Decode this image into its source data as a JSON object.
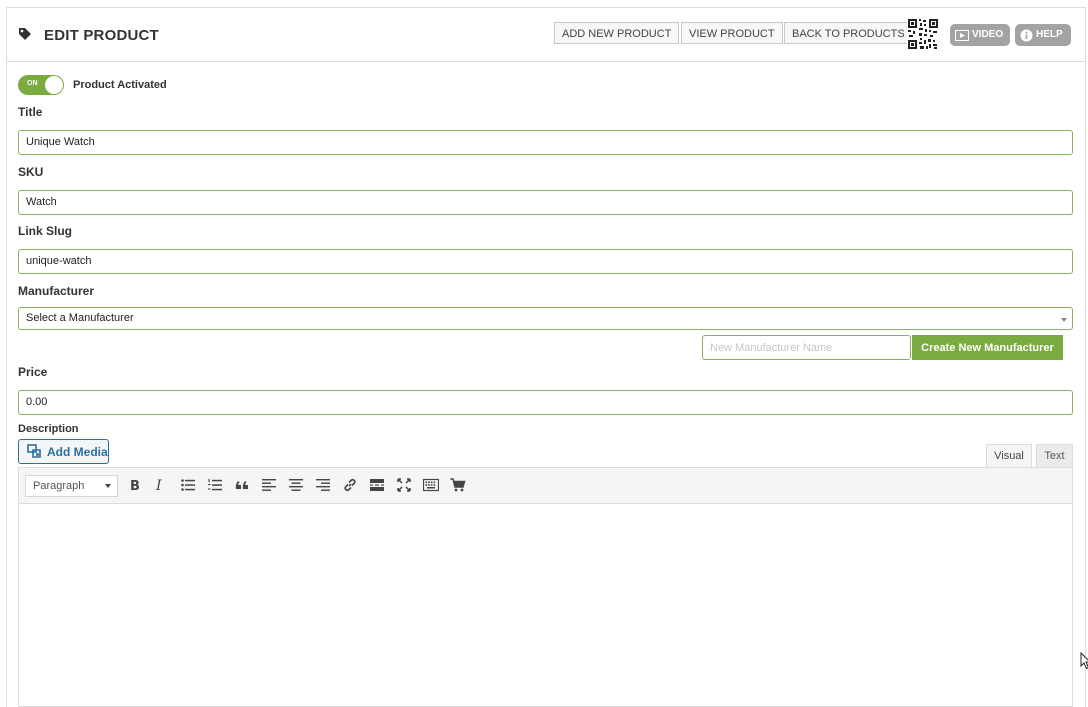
{
  "header": {
    "title": "EDIT PRODUCT",
    "buttons": {
      "add_new_product": "ADD NEW PRODUCT",
      "view_product": "VIEW PRODUCT",
      "back_to_products": "BACK TO PRODUCTS",
      "video": "VIDEO",
      "help": "HELP"
    },
    "icons": [
      "tag-icon",
      "qr-code-icon",
      "video-icon",
      "info-icon"
    ]
  },
  "activation": {
    "toggle_text": "ON",
    "label": "Product Activated",
    "enabled": true
  },
  "fields": {
    "title": {
      "label": "Title",
      "value": "Unique Watch"
    },
    "sku": {
      "label": "SKU",
      "value": "Watch"
    },
    "slug": {
      "label": "Link Slug",
      "value": "unique-watch"
    },
    "manufacturer": {
      "label": "Manufacturer",
      "value": "Select a Manufacturer"
    },
    "new_manufacturer": {
      "placeholder": "New Manufacturer Name",
      "button": "Create New Manufacturer"
    },
    "price": {
      "label": "Price",
      "value": "0.00"
    }
  },
  "description": {
    "label": "Description",
    "add_media": "Add Media",
    "tabs": [
      "Visual",
      "Text"
    ],
    "active_tab": "Visual",
    "format": "Paragraph",
    "toolbar_icons": [
      "bold-icon",
      "italic-icon",
      "bullet-list-icon",
      "numbered-list-icon",
      "blockquote-icon",
      "align-left-icon",
      "align-center-icon",
      "align-right-icon",
      "link-icon",
      "read-more-icon",
      "fullscreen-icon",
      "toolbar-toggle-icon",
      "cart-icon"
    ]
  },
  "colors": {
    "accent": "#7aab3e",
    "input_border": "#8bb25a",
    "media_blue": "#2d6ea0",
    "pill_gray": "#a3a3a3"
  }
}
